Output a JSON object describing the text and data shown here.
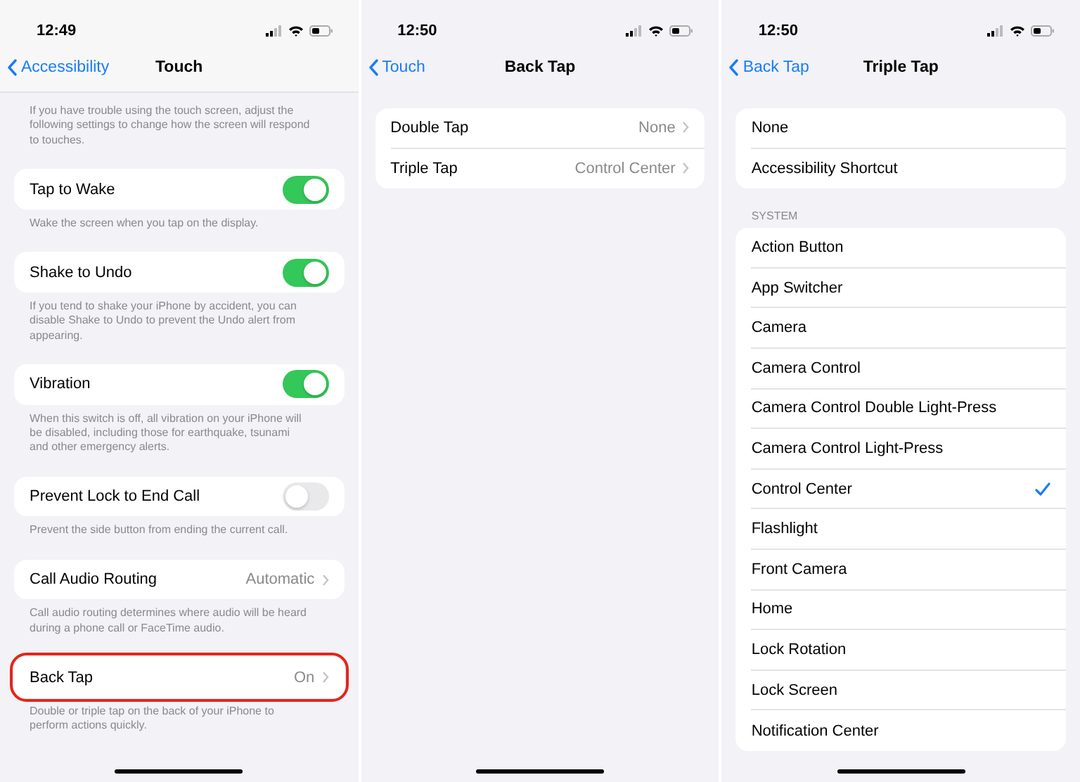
{
  "screens": [
    {
      "time": "12:49",
      "back_label": "Accessibility",
      "title": "Touch",
      "scrolled": true,
      "sections": [
        {
          "footer": "If you have trouble using the touch screen, adjust the following settings to change how the screen will respond to touches."
        },
        {
          "items": [
            {
              "kind": "toggle",
              "label": "Tap to Wake",
              "on": true
            }
          ],
          "footer": "Wake the screen when you tap on the display."
        },
        {
          "items": [
            {
              "kind": "toggle",
              "label": "Shake to Undo",
              "on": true
            }
          ],
          "footer": "If you tend to shake your iPhone by accident, you can disable Shake to Undo to prevent the Undo alert from appearing."
        },
        {
          "items": [
            {
              "kind": "toggle",
              "label": "Vibration",
              "on": true
            }
          ],
          "footer": "When this switch is off, all vibration on your iPhone will be disabled, including those for earthquake, tsunami and other emergency alerts."
        },
        {
          "items": [
            {
              "kind": "toggle",
              "label": "Prevent Lock to End Call",
              "on": false
            }
          ],
          "footer": "Prevent the side button from ending the current call."
        },
        {
          "items": [
            {
              "kind": "link",
              "label": "Call Audio Routing",
              "value": "Automatic"
            }
          ],
          "footer": "Call audio routing determines where audio will be heard during a phone call or FaceTime audio."
        },
        {
          "highlighted": true,
          "items": [
            {
              "kind": "link",
              "label": "Back Tap",
              "value": "On"
            }
          ],
          "footer": "Double or triple tap on the back of your iPhone to perform actions quickly."
        }
      ]
    },
    {
      "time": "12:50",
      "back_label": "Touch",
      "title": "Back Tap",
      "scrolled": false,
      "sections": [
        {
          "items": [
            {
              "kind": "link",
              "label": "Double Tap",
              "value": "None"
            },
            {
              "kind": "link",
              "label": "Triple Tap",
              "value": "Control Center"
            }
          ]
        }
      ]
    },
    {
      "time": "12:50",
      "back_label": "Back Tap",
      "title": "Triple Tap",
      "scrolled": false,
      "sections": [
        {
          "items": [
            {
              "kind": "option",
              "label": "None",
              "selected": false
            },
            {
              "kind": "option",
              "label": "Accessibility Shortcut",
              "selected": false
            }
          ]
        },
        {
          "header": "SYSTEM",
          "items": [
            {
              "kind": "option",
              "label": "Action Button",
              "selected": false
            },
            {
              "kind": "option",
              "label": "App Switcher",
              "selected": false
            },
            {
              "kind": "option",
              "label": "Camera",
              "selected": false
            },
            {
              "kind": "option",
              "label": "Camera Control",
              "selected": false
            },
            {
              "kind": "option",
              "label": "Camera Control Double Light-Press",
              "selected": false
            },
            {
              "kind": "option",
              "label": "Camera Control Light-Press",
              "selected": false
            },
            {
              "kind": "option",
              "label": "Control Center",
              "selected": true
            },
            {
              "kind": "option",
              "label": "Flashlight",
              "selected": false
            },
            {
              "kind": "option",
              "label": "Front Camera",
              "selected": false
            },
            {
              "kind": "option",
              "label": "Home",
              "selected": false
            },
            {
              "kind": "option",
              "label": "Lock Rotation",
              "selected": false
            },
            {
              "kind": "option",
              "label": "Lock Screen",
              "selected": false
            },
            {
              "kind": "option",
              "label": "Notification Center",
              "selected": false
            }
          ]
        }
      ]
    }
  ]
}
